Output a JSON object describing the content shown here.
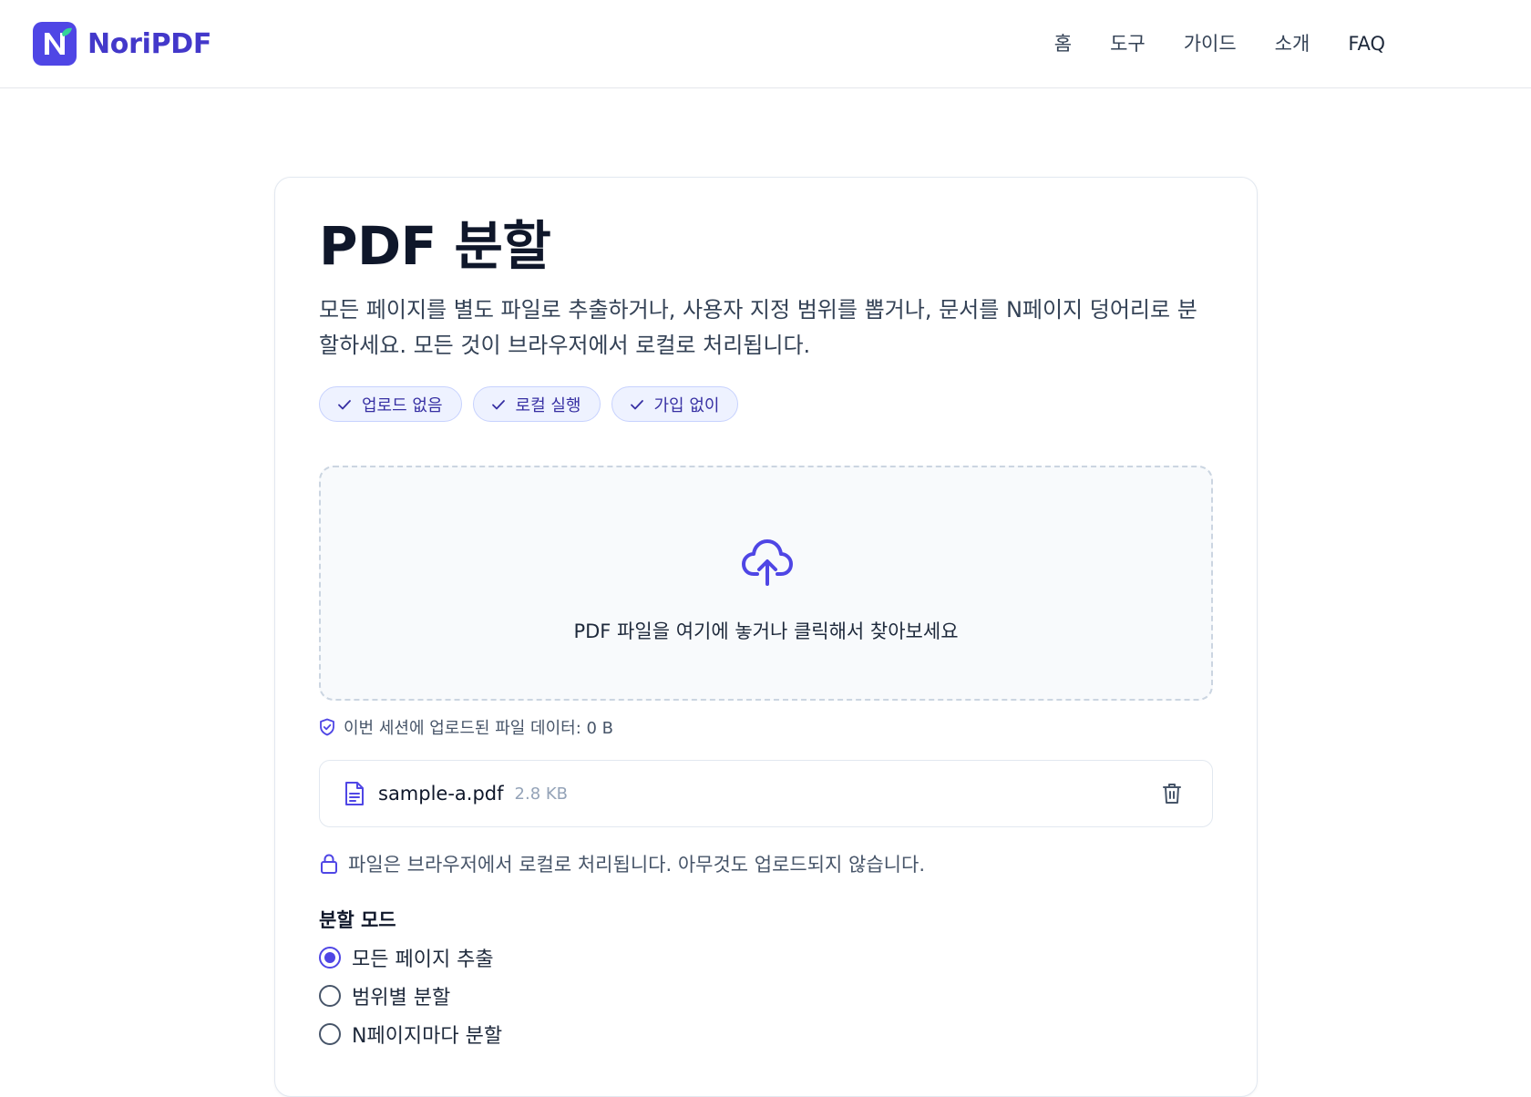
{
  "header": {
    "brand": "NoriPDF",
    "nav": [
      {
        "label": "홈"
      },
      {
        "label": "도구"
      },
      {
        "label": "가이드"
      },
      {
        "label": "소개"
      },
      {
        "label": "FAQ"
      }
    ]
  },
  "tool": {
    "title": "PDF 분할",
    "description": "모든 페이지를 별도 파일로 추출하거나, 사용자 지정 범위를 뽑거나, 문서를 N페이지 덩어리로 분할하세요. 모든 것이 브라우저에서 로컬로 처리됩니다.",
    "badges": [
      {
        "label": "업로드 없음",
        "icon": "check-icon"
      },
      {
        "label": "로컬 실행",
        "icon": "check-icon"
      },
      {
        "label": "가입 없이",
        "icon": "check-icon"
      }
    ]
  },
  "dropzone": {
    "icon": "cloud-upload-icon",
    "text": "PDF 파일을 여기에 놓거나 클릭해서 찾아보세요"
  },
  "session_note": {
    "icon": "shield-check-icon",
    "text": "이번 세션에 업로드된 파일 데이터: 0 B"
  },
  "file": {
    "icon": "document-icon",
    "name": "sample-a.pdf",
    "size": "2.8 KB",
    "delete_icon": "trash-icon"
  },
  "privacy_note": {
    "icon": "lock-icon",
    "text": "파일은 브라우저에서 로컬로 처리됩니다. 아무것도 업로드되지 않습니다."
  },
  "split_mode": {
    "label": "분할 모드",
    "options": [
      {
        "label": "모든 페이지 추출",
        "selected": true
      },
      {
        "label": "범위별 분할",
        "selected": false
      },
      {
        "label": "N페이지마다 분할",
        "selected": false
      }
    ]
  },
  "colors": {
    "accent": "#4f46e5",
    "brand_text": "#4338ca",
    "badge_bg": "#eef2ff",
    "badge_border": "#c7d2fe",
    "dropzone_bg": "#f8fafc"
  }
}
